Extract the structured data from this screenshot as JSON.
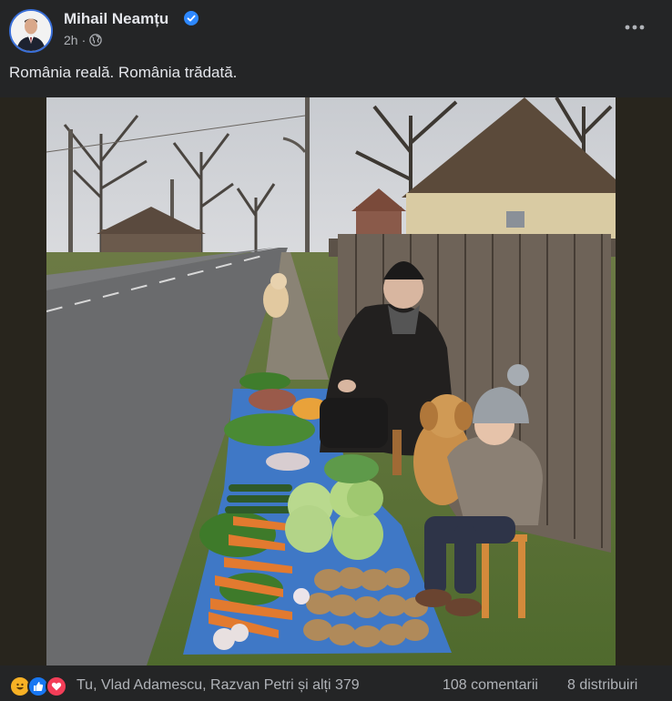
{
  "post": {
    "author": "Mihail Neamțu",
    "time": "2h",
    "separator": "·",
    "text": "România reală. România trădată."
  },
  "icons": {
    "verified": "verified-badge-icon",
    "audience": "globe-icon",
    "more": "more-options-icon",
    "reactions": [
      "haha-icon",
      "like-icon",
      "love-icon"
    ]
  },
  "footer": {
    "reaction_names": "Tu, Vlad Adamescu, Razvan Petri și alți 379",
    "comments": "108 comentarii",
    "shares": "8 distribuiri"
  },
  "colors": {
    "background": "#242526",
    "text": "#e4e6eb",
    "secondary_text": "#b0b3b8",
    "verified": "#2d88ff"
  }
}
